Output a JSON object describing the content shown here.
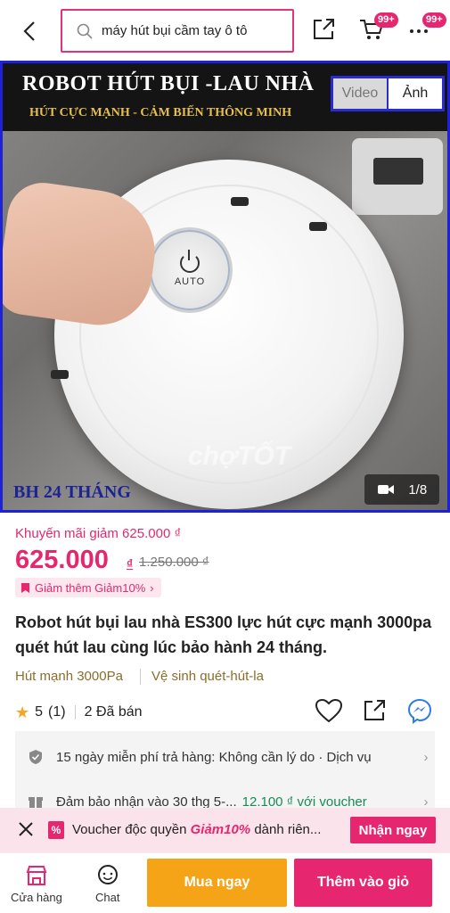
{
  "header": {
    "search_text": "máy hút bụi cầm tay ô tô",
    "cart_badge": "99+",
    "more_badge": "99+"
  },
  "media": {
    "banner_title": "ROBOT HÚT BỤI -LAU NHÀ",
    "banner_subtitle": "HÚT CỰC MẠNH - CẢM BIẾN THÔNG MINH",
    "tab_video": "Video",
    "tab_image": "Ảnh",
    "auto_label": "AUTO",
    "watermark": "chợTỐT",
    "warranty": "BH 24 THÁNG",
    "counter": "1/8"
  },
  "product": {
    "promo_line": "Khuyến mãi giảm 625.000 ₫",
    "price": "625.000",
    "currency": "₫",
    "old_price": "1.250.000 ₫",
    "discount_tag": "Giảm thêm  Giảm10%",
    "title": "Robot hút bụi lau nhà ES300 lực hút cực mạnh 3000pa quét hút lau cùng lúc bảo hành 24 tháng.",
    "feature_1": "Hút mạnh 3000Pa",
    "feature_2": "Vệ sinh quét-hút-la",
    "rating": "5",
    "rating_count": "(1)",
    "sold": "2 Đã bán"
  },
  "info": {
    "return_policy": "15 ngày miễn phí trả hàng: Không cần lý do · Dịch vụ",
    "guarantee": "Đảm bảo nhận vào 30 thg 5-...",
    "guarantee_voucher": "12.100 ₫ với voucher"
  },
  "voucher_bar": {
    "text_before": "Voucher độc quyền ",
    "highlight": "Giảm10%",
    "text_after": " dành riên...",
    "button": "Nhận ngay"
  },
  "bottom_bar": {
    "shop_label": "Cửa hàng",
    "chat_label": "Chat",
    "buy_now": "Mua ngay",
    "add_to_cart": "Thêm vào giỏ"
  },
  "colors": {
    "accent": "#e6276f",
    "buy": "#f5a317",
    "media_border": "#1e22d6"
  }
}
